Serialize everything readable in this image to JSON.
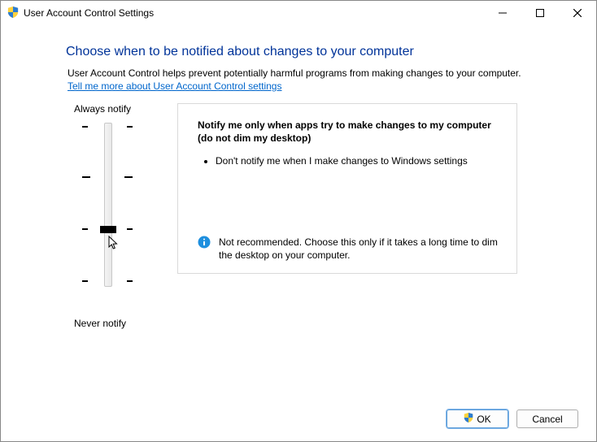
{
  "titlebar": {
    "title": "User Account Control Settings"
  },
  "heading": "Choose when to be notified about changes to your computer",
  "description": "User Account Control helps prevent potentially harmful programs from making changes to your computer.",
  "link_text": "Tell me more about User Account Control settings",
  "slider": {
    "top_label": "Always notify",
    "bottom_label": "Never notify"
  },
  "info": {
    "title": "Notify me only when apps try to make changes to my computer (do not dim my desktop)",
    "bullet1": "Don't notify me when I make changes to Windows settings",
    "footer": "Not recommended. Choose this only if it takes a long time to dim the desktop on your computer."
  },
  "buttons": {
    "ok": "OK",
    "cancel": "Cancel"
  }
}
